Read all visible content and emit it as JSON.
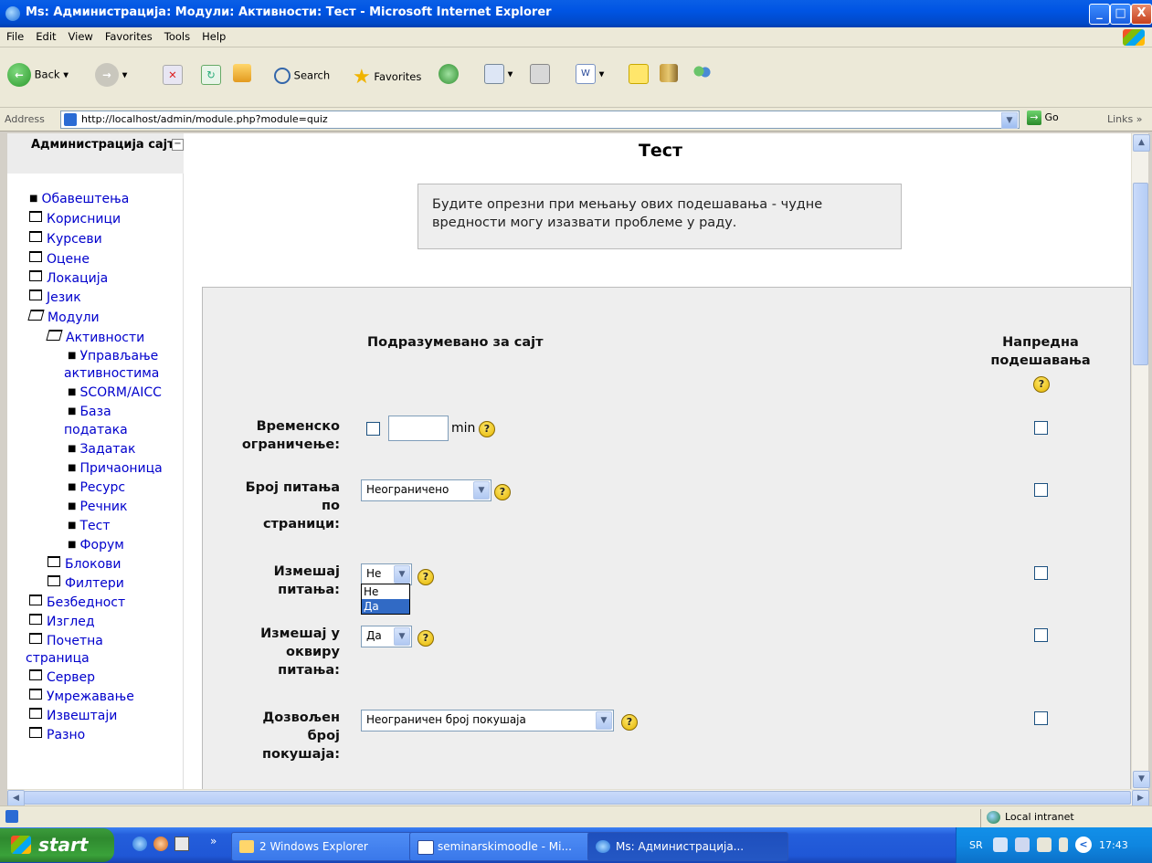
{
  "window": {
    "title": "Ms: Администрација: Модули: Активности: Тест - Microsoft Internet Explorer",
    "controls": {
      "minimize": "_",
      "maximize": "□",
      "close": "X"
    }
  },
  "menu": [
    "File",
    "Edit",
    "View",
    "Favorites",
    "Tools",
    "Help"
  ],
  "toolbar": {
    "back": "Back",
    "search": "Search",
    "favorites": "Favorites"
  },
  "address": {
    "label": "Address",
    "url": "http://localhost/admin/module.php?module=quiz",
    "go": "Go",
    "links": "Links"
  },
  "sidebar": {
    "title": "Администрација сајта",
    "items": [
      {
        "label": "Обавештења",
        "icon": "bullet"
      },
      {
        "label": "Корисници",
        "icon": "folder"
      },
      {
        "label": "Курсеви",
        "icon": "folder"
      },
      {
        "label": "Оцене",
        "icon": "folder"
      },
      {
        "label": "Локација",
        "icon": "folder"
      },
      {
        "label": "Језик",
        "icon": "folder"
      },
      {
        "label": "Модули",
        "icon": "folder-open"
      },
      {
        "label": "Активности",
        "icon": "folder-open"
      },
      {
        "label": "Управљање",
        "icon": "bullet"
      },
      {
        "label": "активностима",
        "icon": "none"
      },
      {
        "label": "SCORM/AICC",
        "icon": "bullet"
      },
      {
        "label": "База",
        "icon": "bullet"
      },
      {
        "label": "података",
        "icon": "none"
      },
      {
        "label": "Задатак",
        "icon": "bullet"
      },
      {
        "label": "Причаоница",
        "icon": "bullet"
      },
      {
        "label": "Ресурс",
        "icon": "bullet"
      },
      {
        "label": "Речник",
        "icon": "bullet"
      },
      {
        "label": "Тест",
        "icon": "bullet"
      },
      {
        "label": "Форум",
        "icon": "bullet"
      },
      {
        "label": "Блокови",
        "icon": "folder"
      },
      {
        "label": "Филтери",
        "icon": "folder"
      },
      {
        "label": "Безбедност",
        "icon": "folder"
      },
      {
        "label": "Изглед",
        "icon": "folder"
      },
      {
        "label": "Почетна",
        "icon": "folder"
      },
      {
        "label": "страница",
        "icon": "none"
      },
      {
        "label": "Сервер",
        "icon": "folder"
      },
      {
        "label": "Умрежавање",
        "icon": "folder"
      },
      {
        "label": "Извештаји",
        "icon": "folder"
      },
      {
        "label": "Разно",
        "icon": "folder"
      }
    ]
  },
  "main": {
    "title": "Тест",
    "warning": [
      "Будите опрезни при мењању ових подешавања - чудне",
      "вредности могу изазвати проблеме у раду."
    ],
    "col_default": "Подразумевано за сајт",
    "col_advanced": [
      "Напредна",
      "подешавања"
    ],
    "help_glyph": "?",
    "fields": {
      "timelimit": {
        "label": [
          "Временско",
          "ограничење:"
        ],
        "unit": "min",
        "value": ""
      },
      "perpage": {
        "label": [
          "Број питања",
          "по",
          "страници:"
        ],
        "value": "Неограничено"
      },
      "shuffle": {
        "label": [
          "Измешај",
          "питања:"
        ],
        "value": "Не",
        "options": [
          "Не",
          "Да"
        ],
        "highlighted": "Да"
      },
      "shuffle_answers": {
        "label": [
          "Измешај у",
          "оквиру",
          "питања:"
        ],
        "value": "Да"
      },
      "attempts": {
        "label": [
          "Дозвољен",
          "број",
          "покушаја:"
        ],
        "value": "Неограничен број покушаја"
      }
    }
  },
  "status": {
    "zone": "Local intranet"
  },
  "taskbar": {
    "start": "start",
    "chevron": "»",
    "tasks": [
      {
        "label": "2 Windows Explorer"
      },
      {
        "label": "seminarskimoodle - Mi..."
      },
      {
        "label": "Ms: Администрација..."
      }
    ],
    "lang": "SR",
    "clock": "17:43"
  }
}
